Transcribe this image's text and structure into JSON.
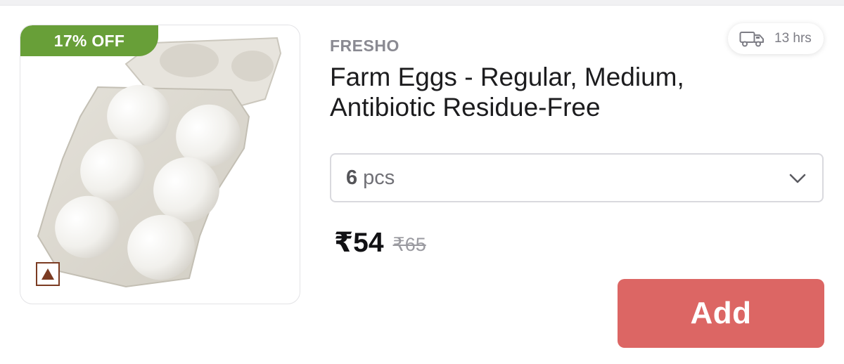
{
  "product": {
    "discount_badge": "17% OFF",
    "brand": "FRESHO",
    "title": "Farm Eggs - Regular, Medium, Antibiotic Residue-Free",
    "delivery_time": "13 hrs",
    "pack": {
      "quantity": "6",
      "unit": "pcs"
    },
    "price": "₹54",
    "mrp": "₹65",
    "add_label": "Add"
  },
  "icons": {
    "delivery": "truck-icon",
    "dropdown": "chevron-down-icon",
    "food_type": "non-veg-triangle-icon"
  },
  "colors": {
    "discount_badge": "#689f38",
    "add_button": "#dc6664",
    "non_veg_mark": "#7b3b22"
  }
}
